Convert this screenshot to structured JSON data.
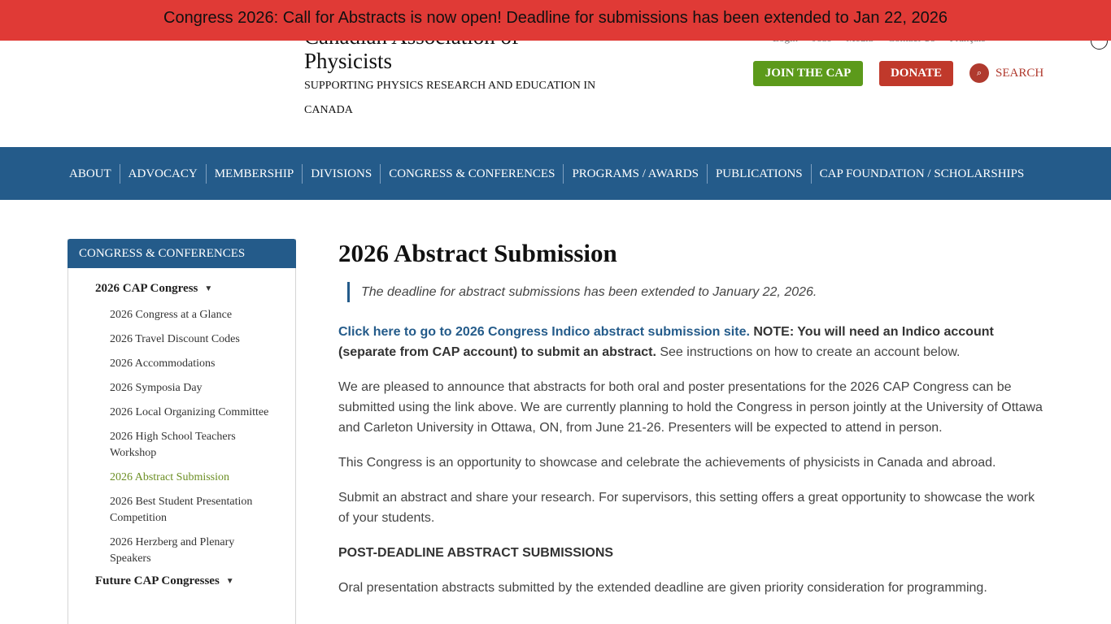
{
  "banner": {
    "text": "Congress 2026: Call for Abstracts is now open! Deadline for submissions has been extended to Jan 22, 2026"
  },
  "header": {
    "title_line1": "Canadian Association of",
    "title_line2": "Physicists",
    "tagline": "SUPPORTING PHYSICS RESEARCH AND EDUCATION IN CANADA",
    "util_links": [
      "Login",
      "Jobs",
      "Media",
      "Contact Us",
      "Français"
    ],
    "join_label": "JOIN THE CAP",
    "donate_label": "DONATE",
    "search_label": "SEARCH",
    "search_icon": "search-icon"
  },
  "nav": {
    "items": [
      "ABOUT",
      "ADVOCACY",
      "MEMBERSHIP",
      "DIVISIONS",
      "CONGRESS & CONFERENCES",
      "PROGRAMS / AWARDS",
      "PUBLICATIONS",
      "CAP FOUNDATION / SCHOLARSHIPS"
    ]
  },
  "sidebar": {
    "heading": "CONGRESS & CONFERENCES",
    "group1": "2026 CAP Congress",
    "items": [
      "2026 Congress at a Glance",
      "2026 Travel Discount Codes",
      "2026 Accommodations",
      "2026 Symposia Day",
      "2026 Local Organizing Committee",
      "2026 High School Teachers Workshop",
      "2026 Abstract Submission",
      "2026 Best Student Presentation Competition",
      "2026 Herzberg and Plenary Speakers"
    ],
    "group2": "Future CAP Congresses"
  },
  "main": {
    "title": "2026 Abstract Submission",
    "quote": "The deadline for abstract submissions has been extended to January 22, 2026.",
    "link_text": "Click here to go to 2026 Congress Indico abstract submission site.",
    "note_bold": "NOTE: You will need an Indico account (separate from CAP account) to submit an abstract.",
    "note_rest": " See instructions on how to create an account below.",
    "para1": "We are pleased to announce that abstracts for both oral and poster presentations for the 2026 CAP Congress can be submitted using the link above. We are currently planning to hold the Congress in person jointly at the University of Ottawa and Carleton University in Ottawa, ON, from June 21-26. Presenters will be expected to attend in person.",
    "para2": "This Congress is an opportunity to showcase and celebrate the achievements of physicists in Canada and abroad.",
    "para3": "Submit an abstract and share your research. For supervisors, this setting offers a great opportunity to showcase the work of your students.",
    "subhead": "POST-DEADLINE ABSTRACT SUBMISSIONS",
    "para4": "Oral presentation abstracts submitted by the extended deadline are given priority consideration for programming."
  },
  "colors": {
    "banner": "#e03a36",
    "nav": "#245b8a",
    "join": "#5c9a1b",
    "donate": "#c0392b",
    "active_link": "#6b8e23"
  }
}
